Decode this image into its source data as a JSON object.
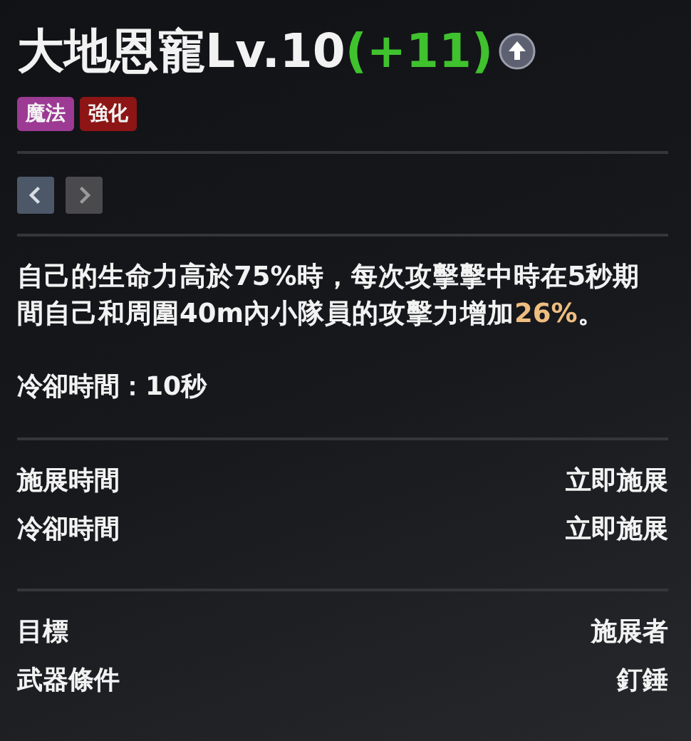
{
  "skill": {
    "name": "大地恩寵Lv.10",
    "bonus": "(+11)",
    "upgradable": true
  },
  "tags": [
    {
      "label": "魔法",
      "color": "#9c3a94"
    },
    {
      "label": "強化",
      "color": "#8e1515"
    }
  ],
  "nav": [
    {
      "kind": "prev",
      "disabled": false
    },
    {
      "kind": "next",
      "disabled": true
    }
  ],
  "description": [
    {
      "text": "自己的生命力高於75%時，每次攻擊擊中時在5秒期間自己和周圍40m內小隊員的攻擊力增加",
      "highlight": false
    },
    {
      "text": "26%",
      "highlight": true
    },
    {
      "text": "。",
      "highlight": false
    }
  ],
  "cooldown": "冷卻時間：10秒",
  "stat_groups": [
    [
      {
        "label": "施展時間",
        "value": "立即施展"
      },
      {
        "label": "冷卻時間",
        "value": "立即施展"
      }
    ],
    [
      {
        "label": "目標",
        "value": "施展者"
      },
      {
        "label": "武器條件",
        "value": "釘錘"
      }
    ]
  ]
}
